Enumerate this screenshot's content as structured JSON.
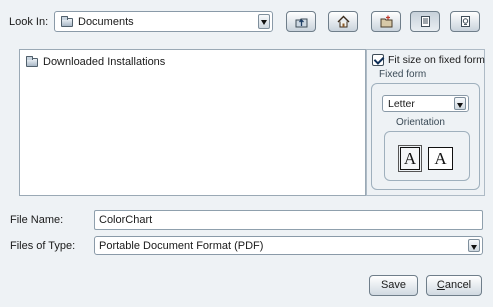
{
  "look_in": {
    "label": "Look In:",
    "value": "Documents"
  },
  "toolbar": {
    "icons": [
      "up-folder-icon",
      "home-icon",
      "new-folder-icon",
      "list-view-icon",
      "details-view-icon"
    ]
  },
  "file_list": {
    "items": [
      {
        "name": "Downloaded Installations",
        "icon": "folder-icon"
      }
    ]
  },
  "accessory": {
    "fit_label": "Fit size on fixed form",
    "fit_checked": true,
    "fixed_form_label": "Fixed form",
    "paper_size": "Letter",
    "orientation_label": "Orientation",
    "portrait_glyph": "A",
    "landscape_glyph": "A"
  },
  "file_name": {
    "label": "File Name:",
    "value": "ColorChart"
  },
  "file_type": {
    "label": "Files of Type:",
    "value": "Portable Document Format (PDF)"
  },
  "buttons": {
    "save": "Save",
    "cancel_mnemonic": "C",
    "cancel_rest": "ancel"
  }
}
